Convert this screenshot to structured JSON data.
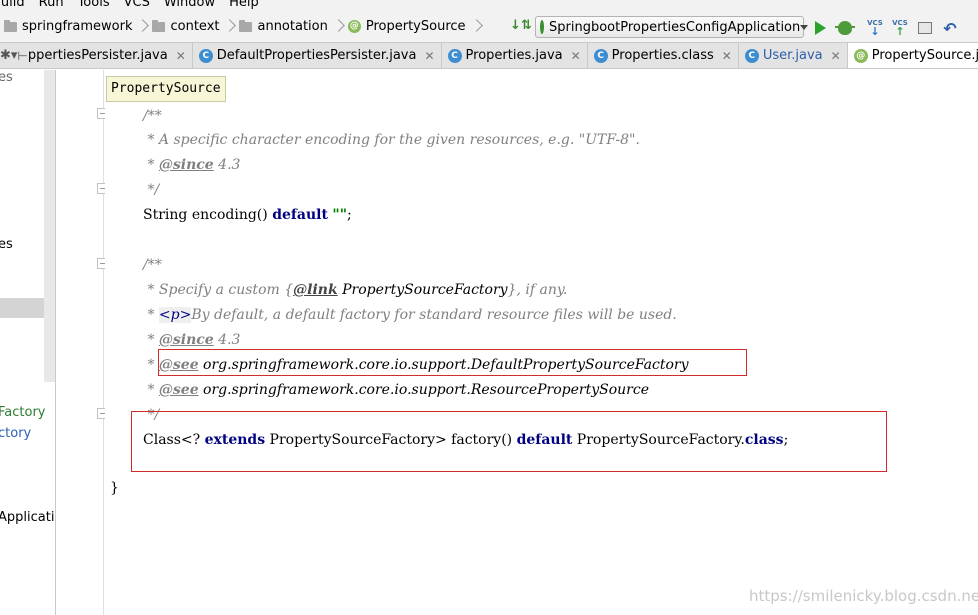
{
  "menu": [
    "Build",
    "Run",
    "Tools",
    "VCS",
    "Window",
    "Help"
  ],
  "breadcrumbs": [
    {
      "label": "springframework",
      "icon": "folder-icon"
    },
    {
      "label": "context",
      "icon": "folder-icon"
    },
    {
      "label": "annotation",
      "icon": "folder-icon"
    },
    {
      "label": "PropertySource",
      "icon": "annotation-icon"
    }
  ],
  "run_config": {
    "label": "SpringbootPropertiesConfigApplication"
  },
  "vcs_label": "VCS",
  "tabs": [
    {
      "label": "ppertiesPersister.java",
      "icon": "java-class-icon",
      "active": false
    },
    {
      "label": "DefaultPropertiesPersister.java",
      "icon": "java-class-icon",
      "active": false
    },
    {
      "label": "Properties.java",
      "icon": "java-class-icon",
      "active": false
    },
    {
      "label": "Properties.class",
      "icon": "java-class-icon",
      "active": false
    },
    {
      "label": "User.java",
      "icon": "java-class-icon",
      "active": false
    },
    {
      "label": "PropertySource.java",
      "icon": "annotation-icon",
      "active": true
    }
  ],
  "tab_overflow": "≡",
  "project_items": [
    "es",
    "es",
    "Factory",
    "ctory",
    "Applicatio"
  ],
  "tooltip": "PropertySource",
  "code": {
    "l1": "/**",
    "l2_pre": " * A specific character encoding for the given resources, e.g. \"UTF-8\".",
    "l3_tag": "@since",
    "l3_rest": " 4.3",
    "l4": " */",
    "l5_a": "String encoding() ",
    "l5_kw": "default",
    "l5_str": "\"\"",
    "l5_end": ";",
    "l7": "/**",
    "l8_a": " * Specify a custom {",
    "l8_tag": "@link",
    "l8_ref": " PropertySourceFactory",
    "l8_b": "}, if any.",
    "l9_a": " * ",
    "l9_tag": "<p>",
    "l9_b": "By default, a default factory for standard resource files will be used.",
    "l10_tag": "@since",
    "l10_rest": " 4.3",
    "l11_tag": "@see",
    "l11_ref": " org.springframework.core.io.support.DefaultPropertySourceFactory",
    "l12_tag": "@see",
    "l12_ref": " org.springframework.core.io.support.ResourcePropertySource",
    "l13": " */",
    "l14_a": "Class<? ",
    "l14_kw1": "extends",
    "l14_b": " PropertySourceFactory> factory() ",
    "l14_kw2": "default",
    "l14_c": " PropertySourceFactory.",
    "l14_kw3": "class",
    "l14_end": ";",
    "l16": "}"
  },
  "watermark": "https://smilenicky.blog.csdn.net"
}
